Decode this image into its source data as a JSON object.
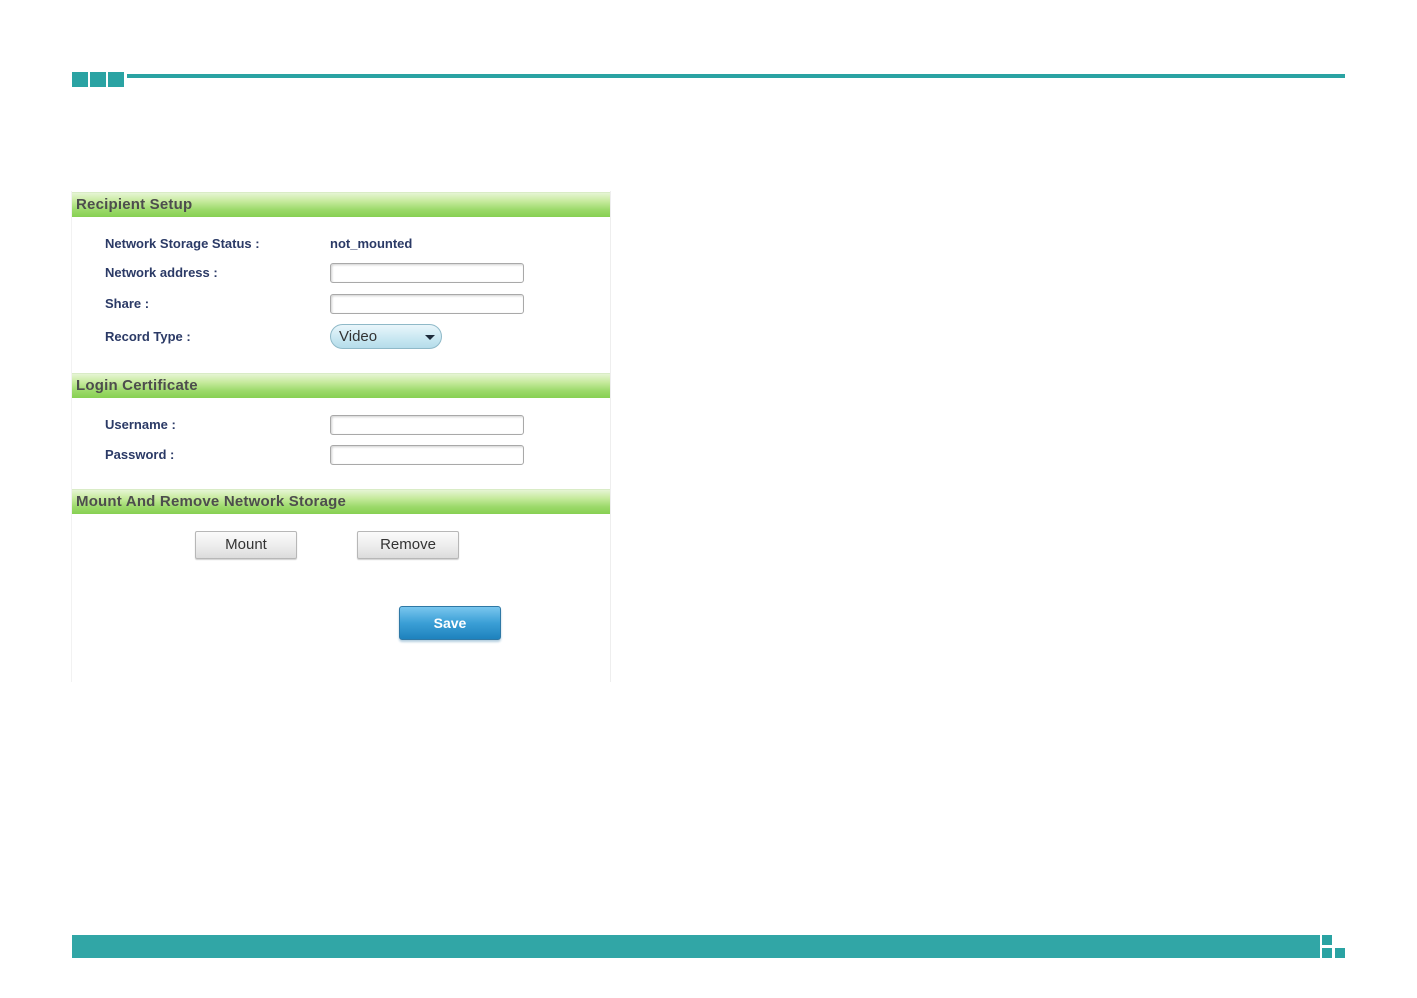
{
  "colors": {
    "accent": "#2aa3a3",
    "section_header": "#9cd96a",
    "label_text": "#2b3a66",
    "save_button": "#3b9fd6"
  },
  "recipient_setup": {
    "title": "Recipient Setup",
    "status_label": "Network Storage Status :",
    "status_value": "not_mounted",
    "address_label": "Network address :",
    "address_value": "",
    "share_label": "Share :",
    "share_value": "",
    "record_type_label": "Record Type :",
    "record_type_value": "Video"
  },
  "login_certificate": {
    "title": "Login Certificate",
    "username_label": "Username :",
    "username_value": "",
    "password_label": "Password :",
    "password_value": ""
  },
  "mount_remove": {
    "title": "Mount And Remove Network Storage",
    "mount_label": "Mount",
    "remove_label": "Remove"
  },
  "save_label": "Save"
}
